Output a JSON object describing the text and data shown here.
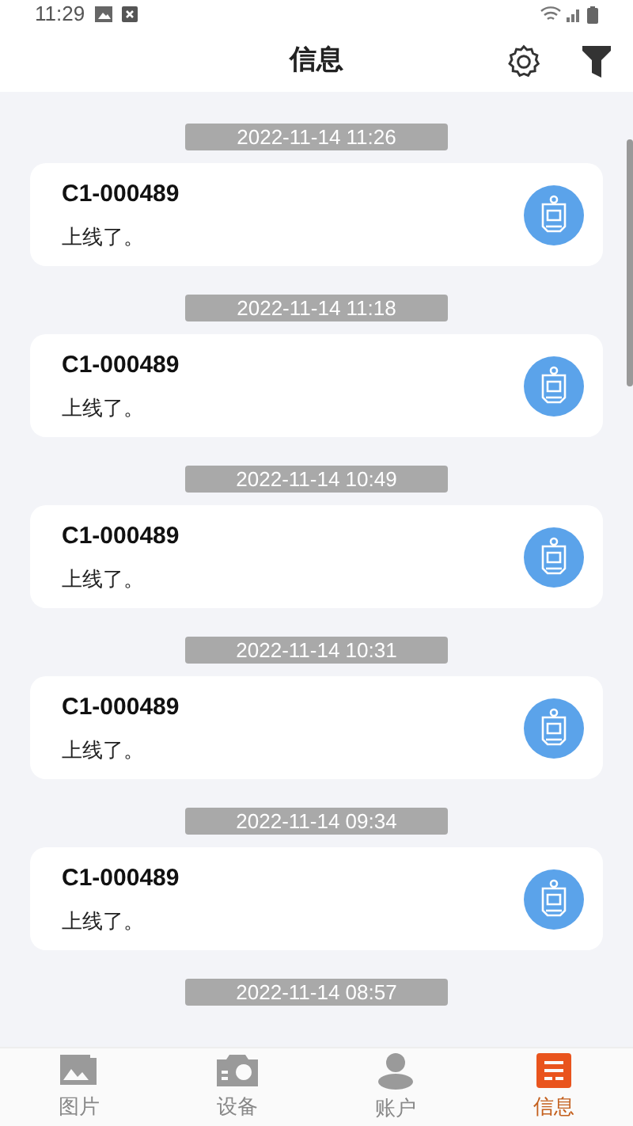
{
  "status_bar": {
    "time": "11:29"
  },
  "header": {
    "title": "信息"
  },
  "messages": [
    {
      "time": "2022-11-14 11:26",
      "device": "C1-000489",
      "text": "上线了。"
    },
    {
      "time": "2022-11-14 11:18",
      "device": "C1-000489",
      "text": "上线了。"
    },
    {
      "time": "2022-11-14 10:49",
      "device": "C1-000489",
      "text": "上线了。"
    },
    {
      "time": "2022-11-14 10:31",
      "device": "C1-000489",
      "text": "上线了。"
    },
    {
      "time": "2022-11-14 09:34",
      "device": "C1-000489",
      "text": "上线了。"
    },
    {
      "time": "2022-11-14 08:57"
    }
  ],
  "tabs": [
    {
      "label": "图片",
      "kind": "pictures",
      "selected": false
    },
    {
      "label": "设备",
      "kind": "camera",
      "selected": false
    },
    {
      "label": "账户",
      "kind": "account",
      "selected": false
    },
    {
      "label": "信息",
      "kind": "messages",
      "selected": true
    }
  ]
}
